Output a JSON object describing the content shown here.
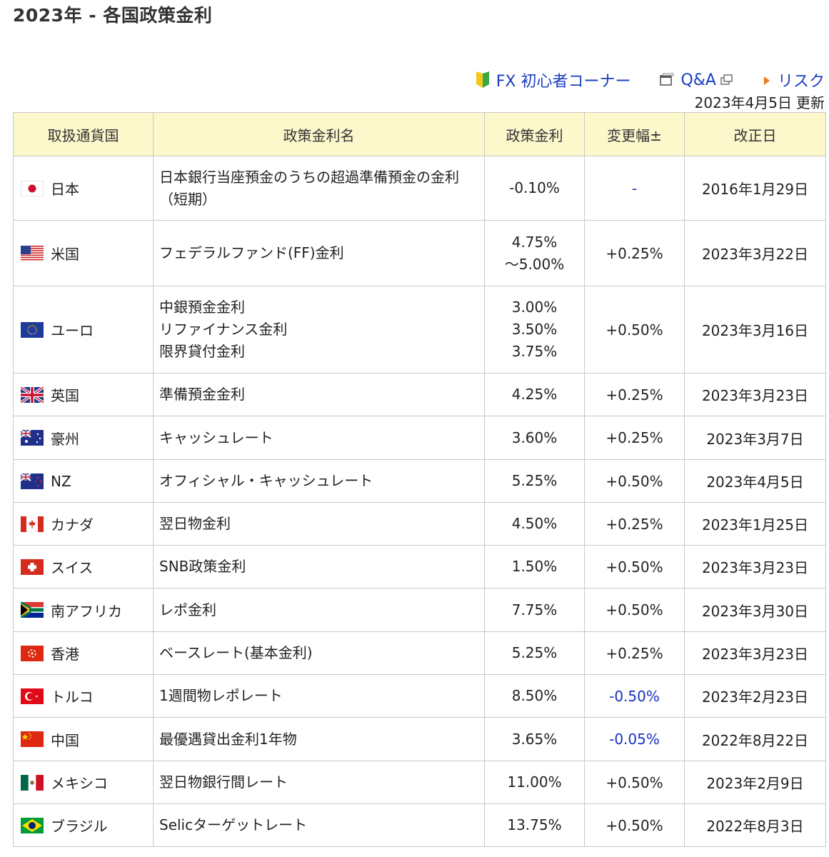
{
  "page": {
    "title": "2023年 - 各国政策金利",
    "links": {
      "beginner": "FX 初心者コーナー",
      "qa": "Q&A",
      "risk": "リスク"
    },
    "updated_date": "2023年4月5日",
    "updated_label": "更新"
  },
  "table": {
    "headers": [
      "取扱通貨国",
      "政策金利名",
      "政策金利",
      "変更幅±",
      "改正日"
    ],
    "rows": [
      {
        "country": "日本",
        "flag": "japan",
        "name": [
          "日本銀行当座預金のうちの超過準備預金の金利",
          "（短期）"
        ],
        "rate": [
          "-0.10%"
        ],
        "change": "-",
        "change_negative": true,
        "date": "2016年1月29日"
      },
      {
        "country": "米国",
        "flag": "usa",
        "name": [
          "フェデラルファンド(FF)金利"
        ],
        "rate": [
          "4.75%",
          "～5.00%"
        ],
        "change": "+0.25%",
        "change_negative": false,
        "date": "2023年3月22日"
      },
      {
        "country": "ユーロ",
        "flag": "eu",
        "name": [
          "中銀預金金利",
          "リファイナンス金利",
          "限界貸付金利"
        ],
        "rate": [
          "3.00%",
          "3.50%",
          "3.75%"
        ],
        "change": "+0.50%",
        "change_negative": false,
        "date": "2023年3月16日"
      },
      {
        "country": "英国",
        "flag": "uk",
        "name": [
          "準備預金金利"
        ],
        "rate": [
          "4.25%"
        ],
        "change": "+0.25%",
        "change_negative": false,
        "date": "2023年3月23日"
      },
      {
        "country": "豪州",
        "flag": "australia",
        "name": [
          "キャッシュレート"
        ],
        "rate": [
          "3.60%"
        ],
        "change": "+0.25%",
        "change_negative": false,
        "date": "2023年3月7日"
      },
      {
        "country": "NZ",
        "flag": "newzealand",
        "name": [
          "オフィシャル・キャッシュレート"
        ],
        "rate": [
          "5.25%"
        ],
        "change": "+0.50%",
        "change_negative": false,
        "date": "2023年4月5日"
      },
      {
        "country": "カナダ",
        "flag": "canada",
        "name": [
          "翌日物金利"
        ],
        "rate": [
          "4.50%"
        ],
        "change": "+0.25%",
        "change_negative": false,
        "date": "2023年1月25日"
      },
      {
        "country": "スイス",
        "flag": "switzerland",
        "name": [
          "SNB政策金利"
        ],
        "rate": [
          "1.50%"
        ],
        "change": "+0.50%",
        "change_negative": false,
        "date": "2023年3月23日"
      },
      {
        "country": "南アフリカ",
        "flag": "southafrica",
        "name": [
          "レポ金利"
        ],
        "rate": [
          "7.75%"
        ],
        "change": "+0.50%",
        "change_negative": false,
        "date": "2023年3月30日"
      },
      {
        "country": "香港",
        "flag": "hongkong",
        "name": [
          "ベースレート(基本金利)"
        ],
        "rate": [
          "5.25%"
        ],
        "change": "+0.25%",
        "change_negative": false,
        "date": "2023年3月23日"
      },
      {
        "country": "トルコ",
        "flag": "turkey",
        "name": [
          "1週間物レポレート"
        ],
        "rate": [
          "8.50%"
        ],
        "change": "-0.50%",
        "change_negative": true,
        "date": "2023年2月23日"
      },
      {
        "country": "中国",
        "flag": "china",
        "name": [
          "最優遇貸出金利1年物"
        ],
        "rate": [
          "3.65%"
        ],
        "change": "-0.05%",
        "change_negative": true,
        "date": "2022年8月22日"
      },
      {
        "country": "メキシコ",
        "flag": "mexico",
        "name": [
          "翌日物銀行間レート"
        ],
        "rate": [
          "11.00%"
        ],
        "change": "+0.50%",
        "change_negative": false,
        "date": "2023年2月9日"
      },
      {
        "country": "ブラジル",
        "flag": "brazil",
        "name": [
          "Selicターゲットレート"
        ],
        "rate": [
          "13.75%"
        ],
        "change": "+0.50%",
        "change_negative": false,
        "date": "2022年8月3日"
      }
    ]
  },
  "colors": {
    "header_bg": "#fdf7cc",
    "link": "#1a3fbf",
    "negative": "#1930c4",
    "border": "#c9c9c9"
  }
}
